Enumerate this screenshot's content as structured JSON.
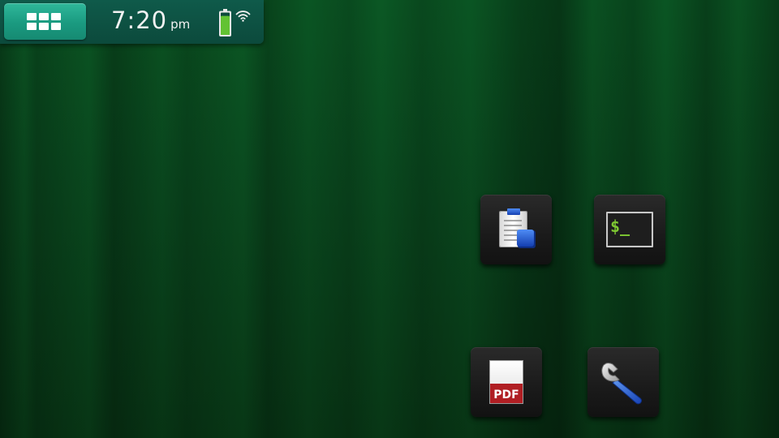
{
  "status_bar": {
    "time": "7:20",
    "ampm": "pm",
    "menu_icon": "grid-icon",
    "battery_icon": "battery-icon",
    "wifi_icon": "wifi-icon",
    "battery_level": 0.85
  },
  "desktop": {
    "icons": [
      {
        "name": "clipboard-document-icon"
      },
      {
        "name": "terminal-icon",
        "glyph": "$_"
      },
      {
        "name": "pdf-document-icon",
        "glyph": "PDF"
      },
      {
        "name": "wrench-icon"
      }
    ]
  },
  "colors": {
    "wallpaper": "#0a4a1f",
    "status_bar": "#0c4a3c",
    "menu_button": "#1a9a80",
    "battery_fill": "#62c232",
    "terminal_prompt": "#7ec832",
    "pdf_red": "#b01e23",
    "clipboard_blue": "#1a4fd0"
  }
}
